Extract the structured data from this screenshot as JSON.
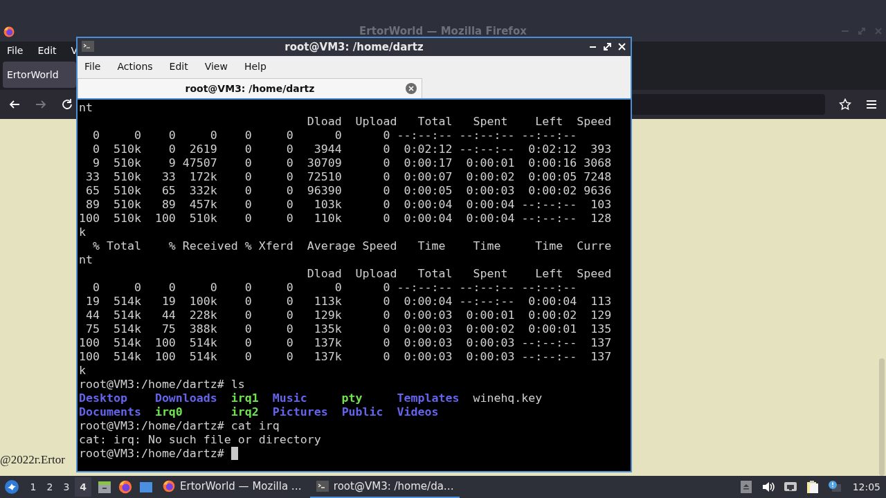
{
  "browser": {
    "title": "ErtorWorld — Mozilla Firefox",
    "menu": [
      "File",
      "Edit",
      "V"
    ],
    "tabs": [
      {
        "label": "ErtorWorld",
        "selected": true
      }
    ],
    "footer_text": "@2022г.Ertor"
  },
  "terminal": {
    "title": "root@VM3: /home/dartz",
    "menu": [
      "File",
      "Actions",
      "Edit",
      "View",
      "Help"
    ],
    "tabs": [
      {
        "label": "root@VM3: /home/dartz",
        "selected": true
      }
    ],
    "lines": [
      {
        "kind": "output",
        "text": "nt"
      },
      {
        "kind": "output",
        "text": "                                 Dload  Upload   Total   Spent    Left  Speed"
      },
      {
        "kind": "output",
        "text": "  0     0    0     0    0     0      0      0 --:--:-- --:--:-- --:--:--"
      },
      {
        "kind": "output",
        "text": "  0  510k    0  2619    0     0   3944      0  0:02:12 --:--:--  0:02:12  393"
      },
      {
        "kind": "output",
        "text": "  9  510k    9 47507    0     0  30709      0  0:00:17  0:00:01  0:00:16 3068"
      },
      {
        "kind": "output",
        "text": " 33  510k   33  172k    0     0  72510      0  0:00:07  0:00:02  0:00:05 7248"
      },
      {
        "kind": "output",
        "text": " 65  510k   65  332k    0     0  96390      0  0:00:05  0:00:03  0:00:02 9636"
      },
      {
        "kind": "output",
        "text": " 89  510k   89  457k    0     0   103k      0  0:00:04  0:00:04 --:--:--  103"
      },
      {
        "kind": "output",
        "text": "100  510k  100  510k    0     0   110k      0  0:00:04  0:00:04 --:--:--  128"
      },
      {
        "kind": "output",
        "text": "k"
      },
      {
        "kind": "output",
        "text": "  % Total    % Received % Xferd  Average Speed   Time    Time     Time  Curre"
      },
      {
        "kind": "output",
        "text": "nt"
      },
      {
        "kind": "output",
        "text": "                                 Dload  Upload   Total   Spent    Left  Speed"
      },
      {
        "kind": "output",
        "text": "  0     0    0     0    0     0      0      0 --:--:-- --:--:-- --:--:--"
      },
      {
        "kind": "output",
        "text": " 19  514k   19  100k    0     0   113k      0  0:00:04 --:--:--  0:00:04  113"
      },
      {
        "kind": "output",
        "text": " 44  514k   44  228k    0     0   129k      0  0:00:03  0:00:01  0:00:02  129"
      },
      {
        "kind": "output",
        "text": " 75  514k   75  388k    0     0   135k      0  0:00:03  0:00:02  0:00:01  135"
      },
      {
        "kind": "output",
        "text": "100  514k  100  514k    0     0   137k      0  0:00:03  0:00:03 --:--:--  137"
      },
      {
        "kind": "output",
        "text": "100  514k  100  514k    0     0   137k      0  0:00:03  0:00:03 --:--:--  137"
      },
      {
        "kind": "output",
        "text": "k"
      },
      {
        "kind": "output",
        "text": "root@VM3:/home/dartz# ls"
      },
      {
        "kind": "listing",
        "rows": [
          [
            {
              "name": "Desktop",
              "kind": "directory"
            },
            {
              "name": "Downloads",
              "kind": "directory"
            },
            {
              "name": "irq1",
              "kind": "executable"
            },
            {
              "name": "Music",
              "kind": "directory"
            },
            {
              "name": "pty",
              "kind": "executable"
            },
            {
              "name": "Templates",
              "kind": "directory"
            },
            {
              "name": "winehq.key",
              "kind": "file"
            }
          ],
          [
            {
              "name": "Documents",
              "kind": "directory"
            },
            {
              "name": "irq0",
              "kind": "executable"
            },
            {
              "name": "irq2",
              "kind": "executable"
            },
            {
              "name": "Pictures",
              "kind": "directory"
            },
            {
              "name": "Public",
              "kind": "directory"
            },
            {
              "name": "Videos",
              "kind": "directory"
            }
          ]
        ]
      },
      {
        "kind": "output",
        "text": "root@VM3:/home/dartz# cat irq"
      },
      {
        "kind": "output",
        "text": "cat: irq: No such file or directory"
      },
      {
        "kind": "output",
        "text": "root@VM3:/home/dartz# ",
        "cursor": true
      }
    ]
  },
  "taskbar": {
    "workspaces": [
      {
        "label": "1",
        "selected": false
      },
      {
        "label": "2",
        "selected": false
      },
      {
        "label": "3",
        "selected": false
      },
      {
        "label": "4",
        "selected": true
      }
    ],
    "tasks": [
      {
        "label": "ErtorWorld — Mozilla …",
        "kind": "browser",
        "selected": false
      },
      {
        "label": "root@VM3: /home/da…",
        "kind": "terminal",
        "selected": true
      }
    ],
    "clock": "12:05"
  }
}
